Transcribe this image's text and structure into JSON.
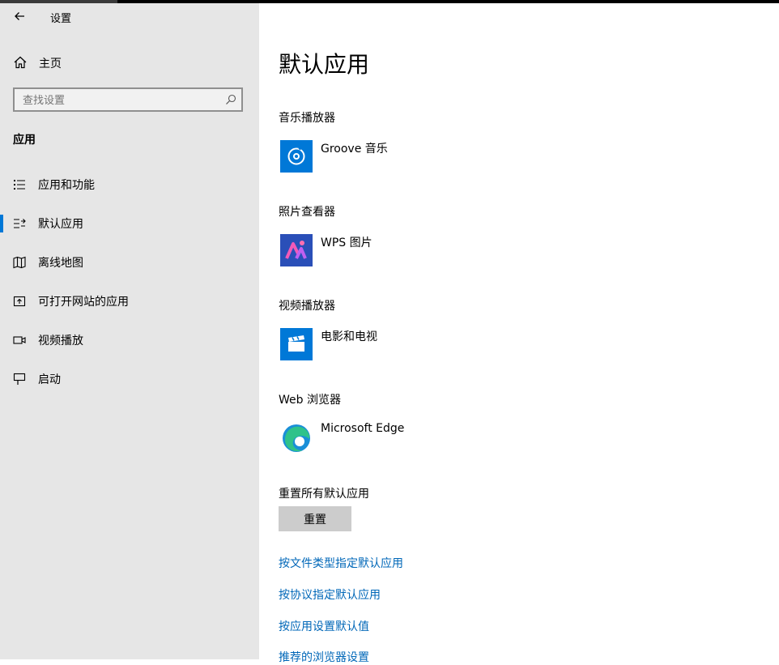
{
  "window": {
    "title": "设置"
  },
  "sidebar": {
    "home_label": "主页",
    "search_placeholder": "查找设置",
    "section_title": "应用",
    "items": [
      {
        "label": "应用和功能",
        "icon": "apps-list-icon"
      },
      {
        "label": "默认应用",
        "icon": "default-apps-icon",
        "selected": true
      },
      {
        "label": "离线地图",
        "icon": "map-icon"
      },
      {
        "label": "可打开网站的应用",
        "icon": "open-website-icon"
      },
      {
        "label": "视频播放",
        "icon": "video-icon"
      },
      {
        "label": "启动",
        "icon": "startup-icon"
      }
    ]
  },
  "main": {
    "title": "默认应用",
    "categories": [
      {
        "heading": "音乐播放器",
        "app": "Groove 音乐",
        "icon": "groove-music-icon"
      },
      {
        "heading": "照片查看器",
        "app": "WPS 图片",
        "icon": "wps-pictures-icon"
      },
      {
        "heading": "视频播放器",
        "app": "电影和电视",
        "icon": "movies-tv-icon"
      },
      {
        "heading": "Web 浏览器",
        "app": "Microsoft Edge",
        "icon": "edge-icon"
      }
    ],
    "reset": {
      "heading": "重置所有默认应用",
      "button_label": "重置"
    },
    "links": [
      "按文件类型指定默认应用",
      "按协议指定默认应用",
      "按应用设置默认值",
      "推荐的浏览器设置"
    ]
  },
  "colors": {
    "accent": "#0078d7",
    "link": "#0067b8",
    "sidebar_bg": "#e6e6e6",
    "button_bg": "#cccccc"
  }
}
